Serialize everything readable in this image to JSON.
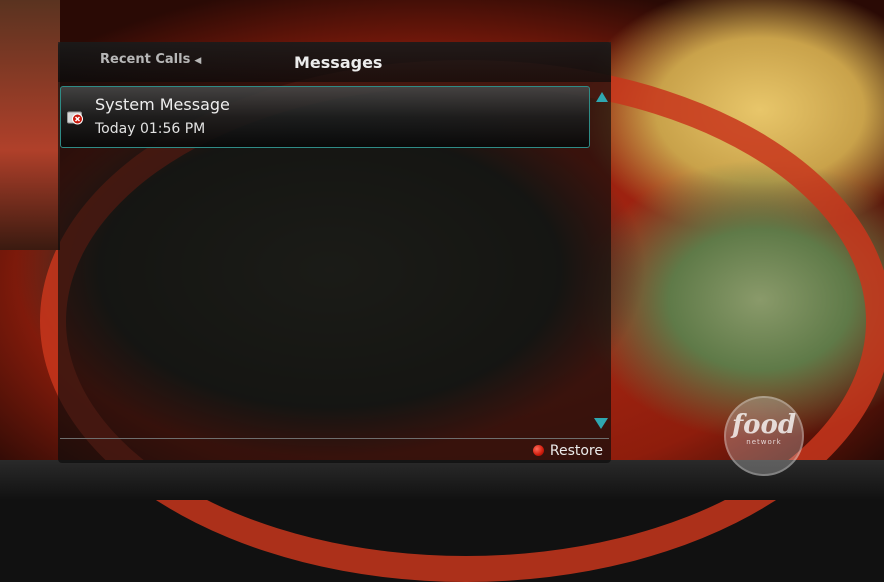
{
  "panel": {
    "back_tab": "Recent Calls",
    "title": "Messages"
  },
  "messages": [
    {
      "title": "System Message",
      "time": "Today 01:56 PM",
      "icon": "message-unread-x-icon"
    }
  ],
  "footer": {
    "restore_label": "Restore",
    "restore_key_color": "#d01c0c"
  },
  "channel_logo": {
    "word": "food",
    "sub": "network"
  },
  "colors": {
    "accent": "#2fa7b0",
    "selection_border": "#2f8b86"
  }
}
